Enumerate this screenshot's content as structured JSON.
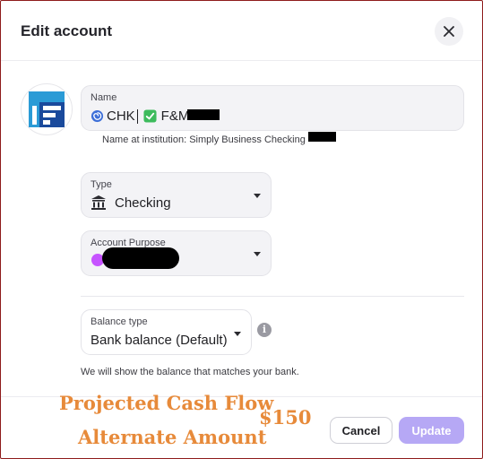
{
  "modal": {
    "title": "Edit account"
  },
  "name_field": {
    "label": "Name",
    "value_prefix": "CHK",
    "value_suffix": "F&M"
  },
  "institution_note": "Name at institution: Simply Business Checking",
  "type_field": {
    "label": "Type",
    "value": "Checking"
  },
  "purpose_field": {
    "label": "Account Purpose"
  },
  "balance_field": {
    "label": "Balance type",
    "value": "Bank balance (Default)"
  },
  "info_icon_glyph": "i",
  "balance_help": "We will show the balance that matches your bank.",
  "buttons": {
    "cancel": "Cancel",
    "update": "Update"
  },
  "annotation": {
    "line1": "Projected Cash Flow",
    "line2": "Alternate Amount",
    "amount": "$150",
    "color": "#e78a3a"
  },
  "colors": {
    "accent": "#b6a8f5",
    "frame": "#8e1b1b"
  }
}
